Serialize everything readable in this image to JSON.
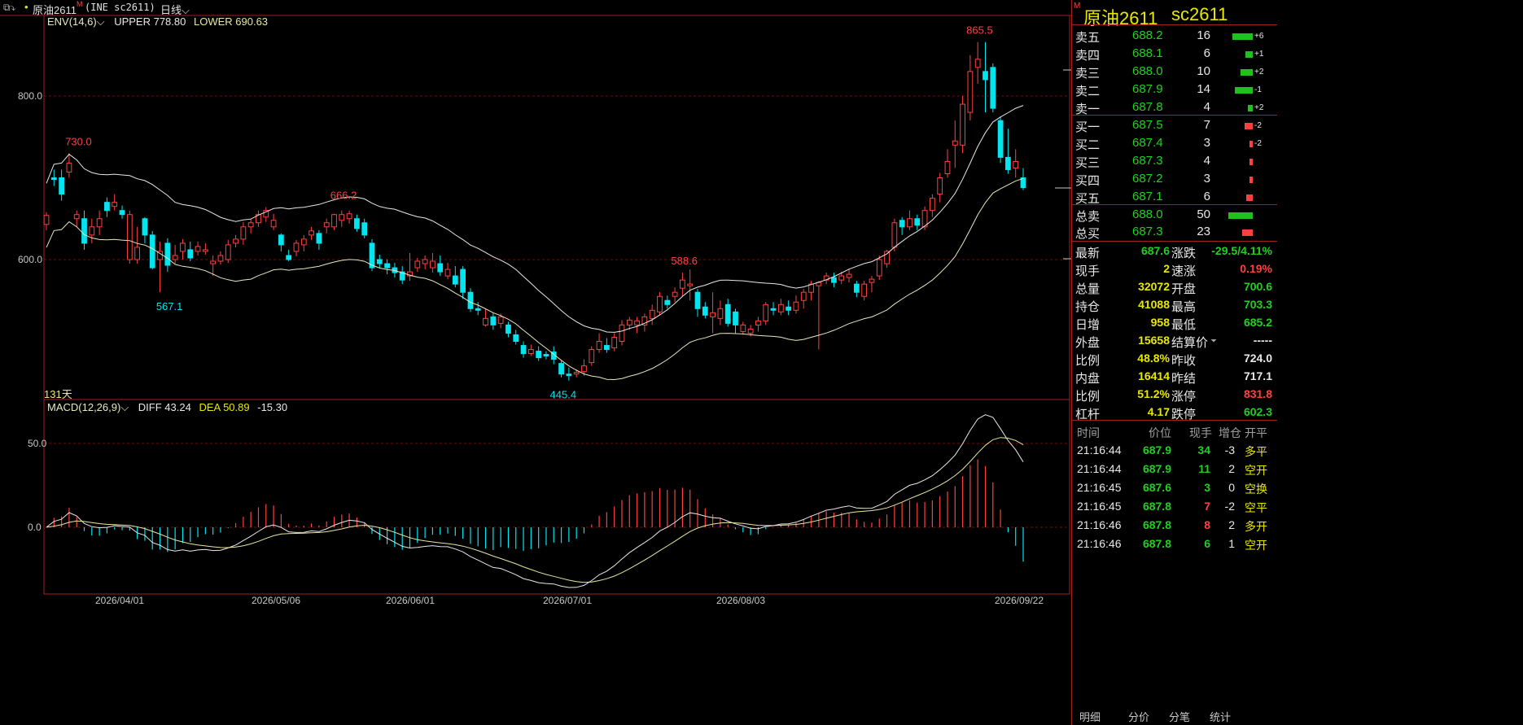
{
  "topbar": {
    "symbol_name": "原油2611",
    "exchange_code": "(INE sc2611)",
    "period": "日线"
  },
  "env": {
    "label": "ENV(14,6)",
    "upper_label": "UPPER 778.80",
    "lower_label": "LOWER 690.63"
  },
  "macd": {
    "label": "MACD(12,26,9)",
    "diff_label": "DIFF 43.24",
    "dea_label": "DEA 50.89",
    "macd_value": "-15.30"
  },
  "days_label": "131天",
  "chart_data": {
    "type": "candlestick",
    "price_axis": {
      "ticks": [
        "800.0",
        "600.0"
      ]
    },
    "macd_axis": {
      "ticks": [
        "50.0",
        "0.0"
      ]
    },
    "x_labels": [
      "2026/04/01",
      "2026/05/06",
      "2026/06/01",
      "2026/07/01",
      "2026/08/03",
      "2026/09/22"
    ],
    "annotations": [
      "730.0",
      "567.1",
      "666.2",
      "445.4",
      "588.6",
      "865.5"
    ],
    "candles": [
      [
        643,
        654,
        636,
        658
      ],
      [
        700,
        698,
        690,
        710
      ],
      [
        700,
        680,
        672,
        710
      ],
      [
        707,
        718,
        700,
        730
      ],
      [
        650,
        655,
        640,
        660
      ],
      [
        650,
        620,
        612,
        660
      ],
      [
        630,
        640,
        620,
        650
      ],
      [
        640,
        650,
        630,
        660
      ],
      [
        670,
        660,
        652,
        676
      ],
      [
        665,
        670,
        660,
        680
      ],
      [
        660,
        655,
        650,
        666
      ],
      [
        600,
        655,
        595,
        660
      ],
      [
        600,
        615,
        595,
        640
      ],
      [
        650,
        630,
        620,
        652
      ],
      [
        630,
        590,
        588,
        635
      ],
      [
        600,
        610,
        560,
        622
      ],
      [
        620,
        593,
        585,
        626
      ],
      [
        600,
        605,
        595,
        618
      ],
      [
        610,
        620,
        600,
        625
      ],
      [
        612,
        602,
        598,
        622
      ],
      [
        610,
        616,
        605,
        622
      ],
      [
        610,
        612,
        606,
        620
      ],
      [
        595,
        598,
        580,
        605
      ],
      [
        598,
        605,
        594,
        610
      ],
      [
        600,
        618,
        596,
        624
      ],
      [
        620,
        625,
        615,
        630
      ],
      [
        625,
        640,
        618,
        646
      ],
      [
        640,
        645,
        632,
        650
      ],
      [
        645,
        655,
        640,
        660
      ],
      [
        652,
        660,
        646,
        664
      ],
      [
        640,
        648,
        636,
        656
      ],
      [
        630,
        618,
        610,
        632
      ],
      [
        605,
        600,
        598,
        612
      ],
      [
        610,
        620,
        604,
        624
      ],
      [
        618,
        625,
        610,
        630
      ],
      [
        630,
        635,
        624,
        640
      ],
      [
        632,
        620,
        612,
        636
      ],
      [
        640,
        645,
        632,
        650
      ],
      [
        640,
        655,
        636,
        656
      ],
      [
        648,
        655,
        640,
        660
      ],
      [
        650,
        656,
        644,
        660
      ],
      [
        650,
        638,
        634,
        655
      ],
      [
        645,
        630,
        626,
        650
      ],
      [
        620,
        590,
        586,
        625
      ],
      [
        600,
        595,
        590,
        606
      ],
      [
        595,
        590,
        582,
        600
      ],
      [
        590,
        584,
        578,
        596
      ],
      [
        585,
        575,
        570,
        592
      ],
      [
        580,
        585,
        574,
        608
      ],
      [
        590,
        598,
        585,
        602
      ],
      [
        595,
        600,
        588,
        605
      ],
      [
        590,
        598,
        584,
        608
      ],
      [
        595,
        585,
        580,
        605
      ],
      [
        580,
        588,
        576,
        596
      ],
      [
        580,
        570,
        566,
        592
      ],
      [
        588,
        560,
        552,
        592
      ],
      [
        560,
        540,
        536,
        565
      ],
      [
        540,
        538,
        532,
        548
      ],
      [
        520,
        528,
        518,
        540
      ],
      [
        530,
        520,
        514,
        535
      ],
      [
        522,
        530,
        516,
        534
      ],
      [
        520,
        510,
        505,
        524
      ],
      [
        508,
        500,
        496,
        514
      ],
      [
        495,
        485,
        480,
        500
      ],
      [
        485,
        490,
        482,
        496
      ],
      [
        488,
        480,
        476,
        494
      ],
      [
        484,
        482,
        478,
        488
      ],
      [
        487,
        478,
        472,
        494
      ],
      [
        473,
        460,
        456,
        476
      ],
      [
        460,
        458,
        452,
        468
      ],
      [
        460,
        462,
        456,
        466
      ],
      [
        463,
        470,
        458,
        478
      ],
      [
        474,
        490,
        470,
        494
      ],
      [
        490,
        500,
        486,
        510
      ],
      [
        495,
        490,
        486,
        504
      ],
      [
        492,
        505,
        488,
        510
      ],
      [
        500,
        520,
        495,
        526
      ],
      [
        520,
        526,
        514,
        530
      ],
      [
        520,
        525,
        510,
        530
      ],
      [
        520,
        530,
        512,
        534
      ],
      [
        528,
        538,
        520,
        545
      ],
      [
        536,
        555,
        532,
        560
      ],
      [
        550,
        545,
        540,
        556
      ],
      [
        555,
        560,
        548,
        566
      ],
      [
        565,
        575,
        555,
        584
      ],
      [
        568,
        570,
        550,
        588
      ],
      [
        560,
        540,
        530,
        564
      ],
      [
        542,
        532,
        528,
        548
      ],
      [
        530,
        535,
        510,
        560
      ],
      [
        528,
        540,
        520,
        550
      ],
      [
        545,
        522,
        518,
        552
      ],
      [
        536,
        520,
        510,
        540
      ],
      [
        512,
        520,
        508,
        524
      ],
      [
        510,
        515,
        506,
        520
      ],
      [
        520,
        525,
        512,
        530
      ],
      [
        525,
        545,
        520,
        548
      ],
      [
        540,
        538,
        532,
        548
      ],
      [
        536,
        545,
        532,
        552
      ],
      [
        542,
        538,
        532,
        550
      ],
      [
        538,
        548,
        534,
        556
      ],
      [
        550,
        560,
        540,
        564
      ],
      [
        560,
        570,
        550,
        574
      ],
      [
        568,
        572,
        490,
        574
      ],
      [
        575,
        580,
        570,
        584
      ],
      [
        578,
        572,
        566,
        584
      ],
      [
        575,
        580,
        570,
        585
      ],
      [
        578,
        582,
        572,
        588
      ],
      [
        570,
        560,
        554,
        574
      ],
      [
        555,
        570,
        550,
        574
      ],
      [
        572,
        576,
        560,
        580
      ],
      [
        580,
        600,
        575,
        605
      ],
      [
        595,
        610,
        590,
        612
      ],
      [
        615,
        645,
        610,
        650
      ],
      [
        648,
        640,
        630,
        652
      ],
      [
        640,
        650,
        636,
        660
      ],
      [
        650,
        642,
        636,
        655
      ],
      [
        640,
        660,
        636,
        665
      ],
      [
        660,
        675,
        652,
        680
      ],
      [
        680,
        700,
        670,
        706
      ],
      [
        705,
        720,
        700,
        735
      ],
      [
        740,
        745,
        712,
        770
      ],
      [
        740,
        790,
        730,
        800
      ],
      [
        780,
        830,
        770,
        850
      ],
      [
        835,
        845,
        815,
        866
      ],
      [
        830,
        820,
        780,
        866
      ],
      [
        835,
        785,
        780,
        840
      ],
      [
        770,
        725,
        718,
        775
      ],
      [
        725,
        710,
        705,
        760
      ],
      [
        712,
        720,
        700,
        735
      ],
      [
        700,
        688,
        685,
        712
      ]
    ]
  },
  "quote": {
    "name": "原油2611",
    "code": "sc2611",
    "asks": [
      {
        "label": "卖五",
        "price": "688.2",
        "vol": "16",
        "chg": "+6",
        "w": 0.85
      },
      {
        "label": "卖四",
        "price": "688.1",
        "vol": "6",
        "chg": "+1",
        "w": 0.3
      },
      {
        "label": "卖三",
        "price": "688.0",
        "vol": "10",
        "chg": "+2",
        "w": 0.5
      },
      {
        "label": "卖二",
        "price": "687.9",
        "vol": "14",
        "chg": "-1",
        "w": 0.75
      },
      {
        "label": "卖一",
        "price": "687.8",
        "vol": "4",
        "chg": "+2",
        "w": 0.2
      }
    ],
    "bids": [
      {
        "label": "买一",
        "price": "687.5",
        "vol": "7",
        "chg": "-2",
        "w": 0.35
      },
      {
        "label": "买二",
        "price": "687.4",
        "vol": "3",
        "chg": "-2",
        "w": 0.12
      },
      {
        "label": "买三",
        "price": "687.3",
        "vol": "4",
        "chg": "",
        "w": 0.15
      },
      {
        "label": "买四",
        "price": "687.2",
        "vol": "3",
        "chg": "",
        "w": 0.12
      },
      {
        "label": "买五",
        "price": "687.1",
        "vol": "6",
        "chg": "",
        "w": 0.28
      }
    ],
    "totals": [
      {
        "label": "总卖",
        "price": "688.0",
        "vol": "50",
        "w": 1.0,
        "color": "green"
      },
      {
        "label": "总买",
        "price": "687.3",
        "vol": "23",
        "w": 0.45,
        "color": "red"
      }
    ],
    "stats_left": [
      {
        "label": "最新",
        "value": "687.6",
        "color": "green"
      },
      {
        "label": "现手",
        "value": "2",
        "color": "yellow"
      },
      {
        "label": "总量",
        "value": "32072",
        "color": "yellow"
      },
      {
        "label": "持仓",
        "value": "41088",
        "color": "yellow"
      },
      {
        "label": "日增",
        "value": "958",
        "color": "yellow"
      },
      {
        "label": "外盘",
        "value": "15658",
        "color": "yellow"
      },
      {
        "label": "比例",
        "value": "48.8%",
        "color": "yellow"
      },
      {
        "label": "内盘",
        "value": "16414",
        "color": "yellow"
      },
      {
        "label": "比例",
        "value": "51.2%",
        "color": "yellow"
      },
      {
        "label": "杠杆",
        "value": "4.17",
        "color": "yellow"
      }
    ],
    "stats_right": [
      {
        "label": "涨跌",
        "value": "-29.5/4.11%",
        "color": "green"
      },
      {
        "label": "速涨",
        "value": "0.19%",
        "color": "red"
      },
      {
        "label": "开盘",
        "value": "700.6",
        "color": "green"
      },
      {
        "label": "最高",
        "value": "703.3",
        "color": "green"
      },
      {
        "label": "最低",
        "value": "685.2",
        "color": "green"
      },
      {
        "label": "结算价",
        "value": "-----",
        "color": "white"
      },
      {
        "label": "昨收",
        "value": "724.0",
        "color": "white"
      },
      {
        "label": "昨结",
        "value": "717.1",
        "color": "white"
      },
      {
        "label": "涨停",
        "value": "831.8",
        "color": "red"
      },
      {
        "label": "跌停",
        "value": "602.3",
        "color": "green"
      }
    ],
    "ticks_header": [
      "时间",
      "价位",
      "现手",
      "增仓",
      "开平"
    ],
    "ticks": [
      {
        "time": "21:16:44",
        "price": "687.9",
        "vol": "34",
        "chg": "-3",
        "type": "多平",
        "vcolor": "green",
        "tcolor": "yellow"
      },
      {
        "time": "21:16:44",
        "price": "687.9",
        "vol": "11",
        "chg": "2",
        "type": "空开",
        "vcolor": "green",
        "tcolor": "yellow"
      },
      {
        "time": "21:16:45",
        "price": "687.6",
        "vol": "3",
        "chg": "0",
        "type": "空换",
        "vcolor": "green",
        "tcolor": "yellow"
      },
      {
        "time": "21:16:45",
        "price": "687.8",
        "vol": "7",
        "chg": "-2",
        "type": "空平",
        "vcolor": "red",
        "tcolor": "yellow"
      },
      {
        "time": "21:16:46",
        "price": "687.8",
        "vol": "8",
        "chg": "2",
        "type": "多开",
        "vcolor": "red",
        "tcolor": "yellow"
      },
      {
        "time": "21:16:46",
        "price": "687.8",
        "vol": "6",
        "chg": "1",
        "type": "空开",
        "vcolor": "green",
        "tcolor": "yellow"
      }
    ],
    "tabs": [
      "明细",
      "分价",
      "分笔",
      "统计"
    ]
  },
  "colors": {
    "up": "#ff4040",
    "down": "#00e5ee",
    "grid": "#6a1010",
    "border": "#a02020",
    "ma": "#e8e8c0"
  }
}
